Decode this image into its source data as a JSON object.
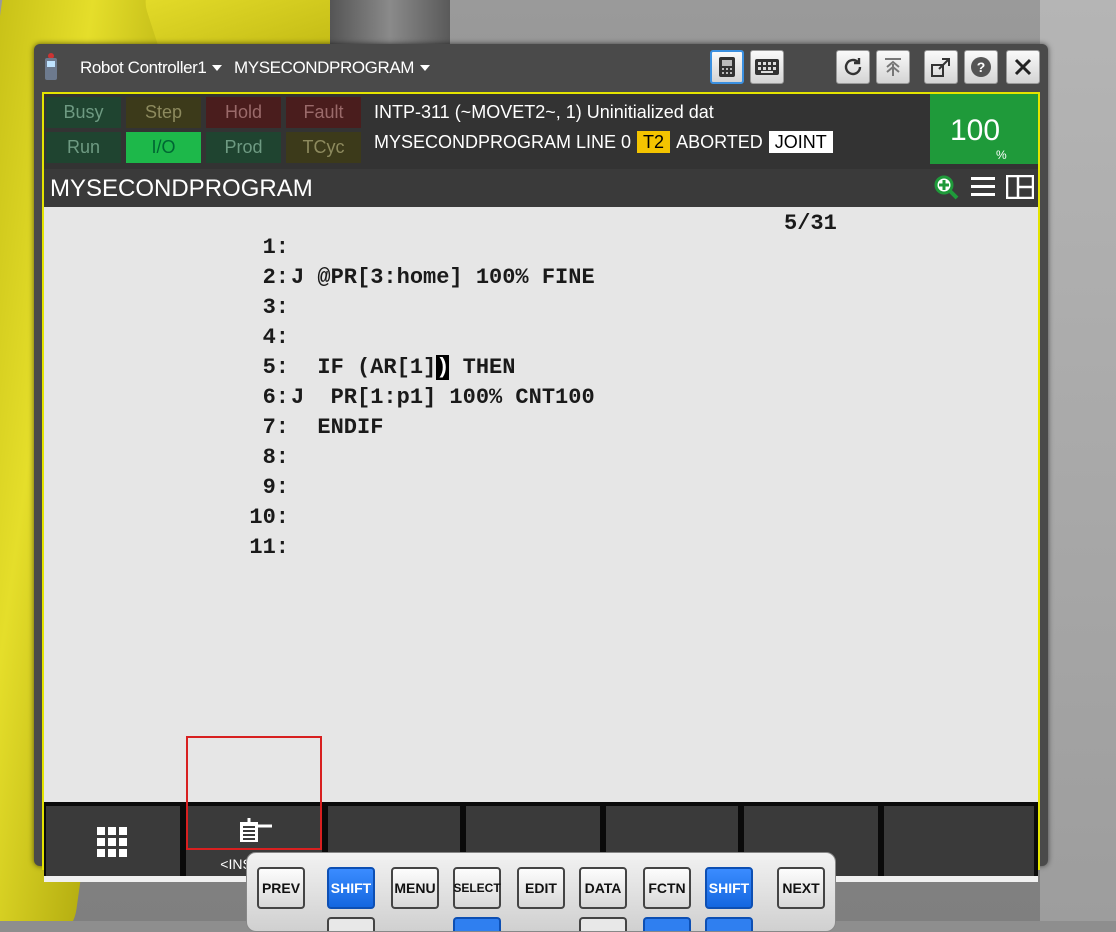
{
  "titlebar": {
    "controller": "Robot Controller1",
    "program": "MYSECONDPROGRAM"
  },
  "status": {
    "busy": "Busy",
    "step": "Step",
    "hold": "Hold",
    "fault": "Fault",
    "run": "Run",
    "io": "I/O",
    "prod": "Prod",
    "tcyc": "TCyc",
    "alarm": "INTP-311 (~MOVET2~, 1) Uninitialized dat",
    "program_line": "MYSECONDPROGRAM LINE 0",
    "mode": "T2",
    "state": "ABORTED",
    "coord": "JOINT",
    "override": "100",
    "override_unit": "%"
  },
  "editor": {
    "title": "MYSECONDPROGRAM",
    "counter": "5/31",
    "lines": [
      {
        "num": "1:",
        "code": ""
      },
      {
        "num": "2:",
        "code": "J @PR[3:home] 100% FINE"
      },
      {
        "num": "3:",
        "code": ""
      },
      {
        "num": "4:",
        "code": ""
      },
      {
        "num": "5:",
        "code_pre": "  IF (AR[1]",
        "cursor": ")",
        "code_post": " THEN"
      },
      {
        "num": "6:",
        "code": "J  PR[1:p1] 100% CNT100"
      },
      {
        "num": "7:",
        "code": "  ENDIF"
      },
      {
        "num": "8:",
        "code": ""
      },
      {
        "num": "9:",
        "code": ""
      },
      {
        "num": "10:",
        "code": ""
      },
      {
        "num": "11:",
        "code": ""
      }
    ]
  },
  "fkeys": {
    "f1_label": "<INSERT>"
  },
  "hardkeys": {
    "prev": "PREV",
    "shift": "SHIFT",
    "menu": "MENU",
    "select": "SELECT",
    "edit": "EDIT",
    "data": "DATA",
    "fctn": "FCTN",
    "next": "NEXT"
  }
}
